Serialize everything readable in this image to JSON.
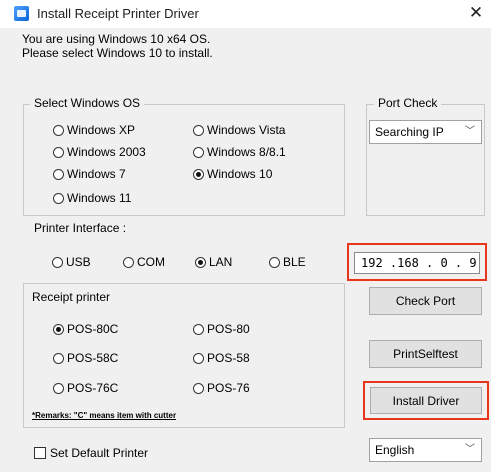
{
  "window": {
    "title": "Install Receipt Printer Driver",
    "close": "✕"
  },
  "message": {
    "line1": "You are using Windows 10 x64 OS.",
    "line2": "Please select Windows 10 to install."
  },
  "os_group": {
    "label": "Select Windows OS",
    "options": [
      "Windows XP",
      "Windows Vista",
      "Windows 2003",
      "Windows 8/8.1",
      "Windows 7",
      "Windows 10",
      "Windows 11"
    ],
    "selected": "Windows 10"
  },
  "port_check": {
    "label": "Port Check",
    "value": "Searching IP"
  },
  "interface": {
    "label": "Printer Interface :",
    "options": [
      "USB",
      "COM",
      "LAN",
      "BLE"
    ],
    "selected": "LAN",
    "ip": "192 .168 . 0  . 9"
  },
  "receipt": {
    "label": "Receipt printer",
    "options": [
      "POS-80C",
      "POS-80",
      "POS-58C",
      "POS-58",
      "POS-76C",
      "POS-76"
    ],
    "selected": "POS-80C",
    "remark": "*Remarks: \"C\" means item with cutter"
  },
  "buttons": {
    "check_port": "Check Port",
    "print_selftest": "PrintSelftest",
    "install_driver": "Install Driver"
  },
  "footer": {
    "default_printer": "Set Default Printer",
    "language": "English"
  },
  "colors": {
    "highlight": "#e8361c",
    "client_bg": "#f0f0f0"
  }
}
